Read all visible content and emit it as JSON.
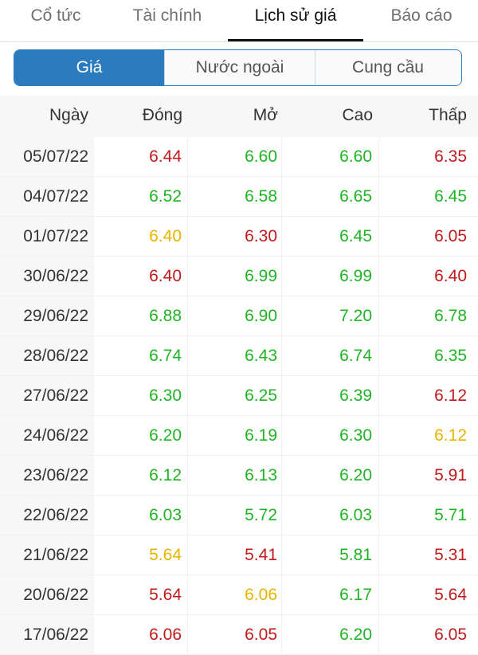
{
  "tabs": [
    {
      "label": "Cổ tức",
      "active": false
    },
    {
      "label": "Tài chính",
      "active": false
    },
    {
      "label": "Lịch sử giá",
      "active": true
    },
    {
      "label": "Báo cáo",
      "active": false
    }
  ],
  "segments": [
    {
      "label": "Giá",
      "active": true
    },
    {
      "label": "Nước ngoài",
      "active": false
    },
    {
      "label": "Cung cầu",
      "active": false
    }
  ],
  "table": {
    "headers": [
      "Ngày",
      "Đóng",
      "Mở",
      "Cao",
      "Thấp"
    ],
    "rows": [
      {
        "date": "05/07/22",
        "close": "6.44",
        "open": "6.60",
        "high": "6.60",
        "low": "6.35",
        "colors": [
          "red",
          "green",
          "green",
          "red"
        ]
      },
      {
        "date": "04/07/22",
        "close": "6.52",
        "open": "6.58",
        "high": "6.65",
        "low": "6.45",
        "colors": [
          "green",
          "green",
          "green",
          "green"
        ]
      },
      {
        "date": "01/07/22",
        "close": "6.40",
        "open": "6.30",
        "high": "6.45",
        "low": "6.05",
        "colors": [
          "yellow",
          "red",
          "green",
          "red"
        ]
      },
      {
        "date": "30/06/22",
        "close": "6.40",
        "open": "6.99",
        "high": "6.99",
        "low": "6.40",
        "colors": [
          "red",
          "green",
          "green",
          "red"
        ]
      },
      {
        "date": "29/06/22",
        "close": "6.88",
        "open": "6.90",
        "high": "7.20",
        "low": "6.78",
        "colors": [
          "green",
          "green",
          "green",
          "green"
        ]
      },
      {
        "date": "28/06/22",
        "close": "6.74",
        "open": "6.43",
        "high": "6.74",
        "low": "6.35",
        "colors": [
          "green",
          "green",
          "green",
          "green"
        ]
      },
      {
        "date": "27/06/22",
        "close": "6.30",
        "open": "6.25",
        "high": "6.39",
        "low": "6.12",
        "colors": [
          "green",
          "green",
          "green",
          "red"
        ]
      },
      {
        "date": "24/06/22",
        "close": "6.20",
        "open": "6.19",
        "high": "6.30",
        "low": "6.12",
        "colors": [
          "green",
          "green",
          "green",
          "yellow"
        ]
      },
      {
        "date": "23/06/22",
        "close": "6.12",
        "open": "6.13",
        "high": "6.20",
        "low": "5.91",
        "colors": [
          "green",
          "green",
          "green",
          "red"
        ]
      },
      {
        "date": "22/06/22",
        "close": "6.03",
        "open": "5.72",
        "high": "6.03",
        "low": "5.71",
        "colors": [
          "green",
          "green",
          "green",
          "green"
        ]
      },
      {
        "date": "21/06/22",
        "close": "5.64",
        "open": "5.41",
        "high": "5.81",
        "low": "5.31",
        "colors": [
          "yellow",
          "red",
          "green",
          "red"
        ]
      },
      {
        "date": "20/06/22",
        "close": "5.64",
        "open": "6.06",
        "high": "6.17",
        "low": "5.64",
        "colors": [
          "red",
          "yellow",
          "green",
          "red"
        ]
      },
      {
        "date": "17/06/22",
        "close": "6.06",
        "open": "6.05",
        "high": "6.20",
        "low": "6.05",
        "colors": [
          "red",
          "red",
          "green",
          "red"
        ]
      }
    ]
  },
  "colors": {
    "accent": "#2b7bbf",
    "up": "#1fb423",
    "down": "#c21a1a",
    "reference": "#e8b400"
  }
}
